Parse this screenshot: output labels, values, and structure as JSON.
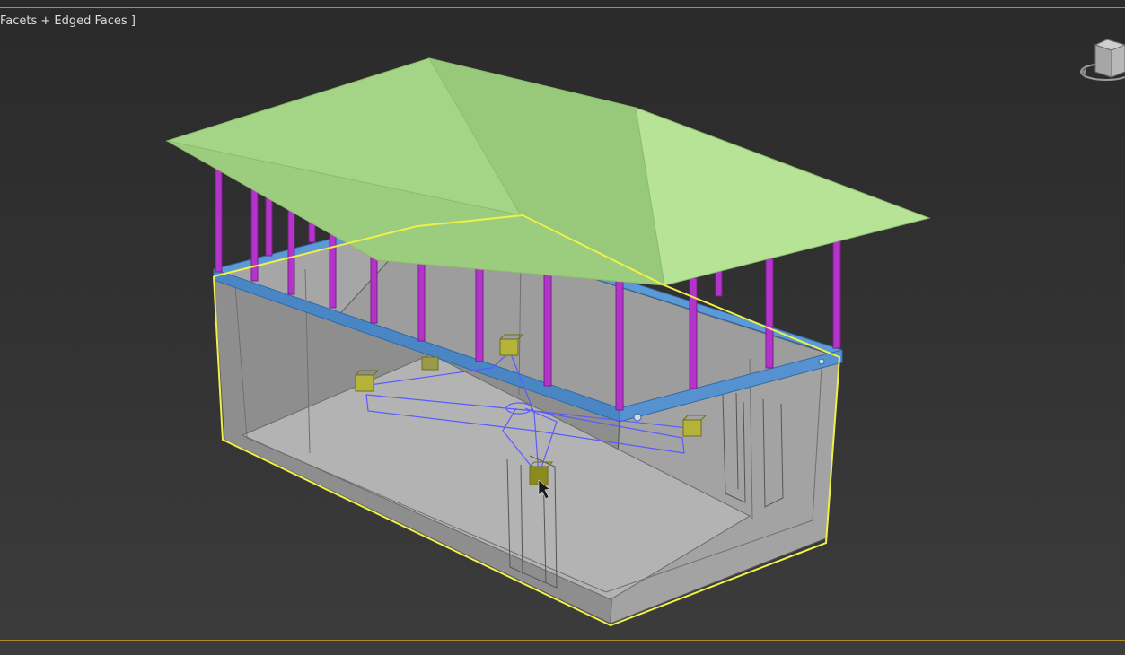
{
  "viewport": {
    "label": "Facets + Edged Faces ]",
    "colors": {
      "background_top": "#2a2a2a",
      "background_bottom": "#3c3c3c",
      "active_border": "#b48a2a",
      "selection_outline": "#f0f04a",
      "roof": "#a8d88a",
      "posts": "#b234c8",
      "beam": "#4a86c4",
      "tank_walls": "#9a9a9a",
      "helpers": "#8e8e2a",
      "frame_lines": "#5a5aff"
    }
  },
  "scene": {
    "objects": [
      "roof",
      "posts",
      "beam-ring",
      "tank-box",
      "truss-helper",
      "dummy-helpers",
      "selection-outline"
    ]
  },
  "viewcube": {
    "icon": "viewcube-icon"
  }
}
